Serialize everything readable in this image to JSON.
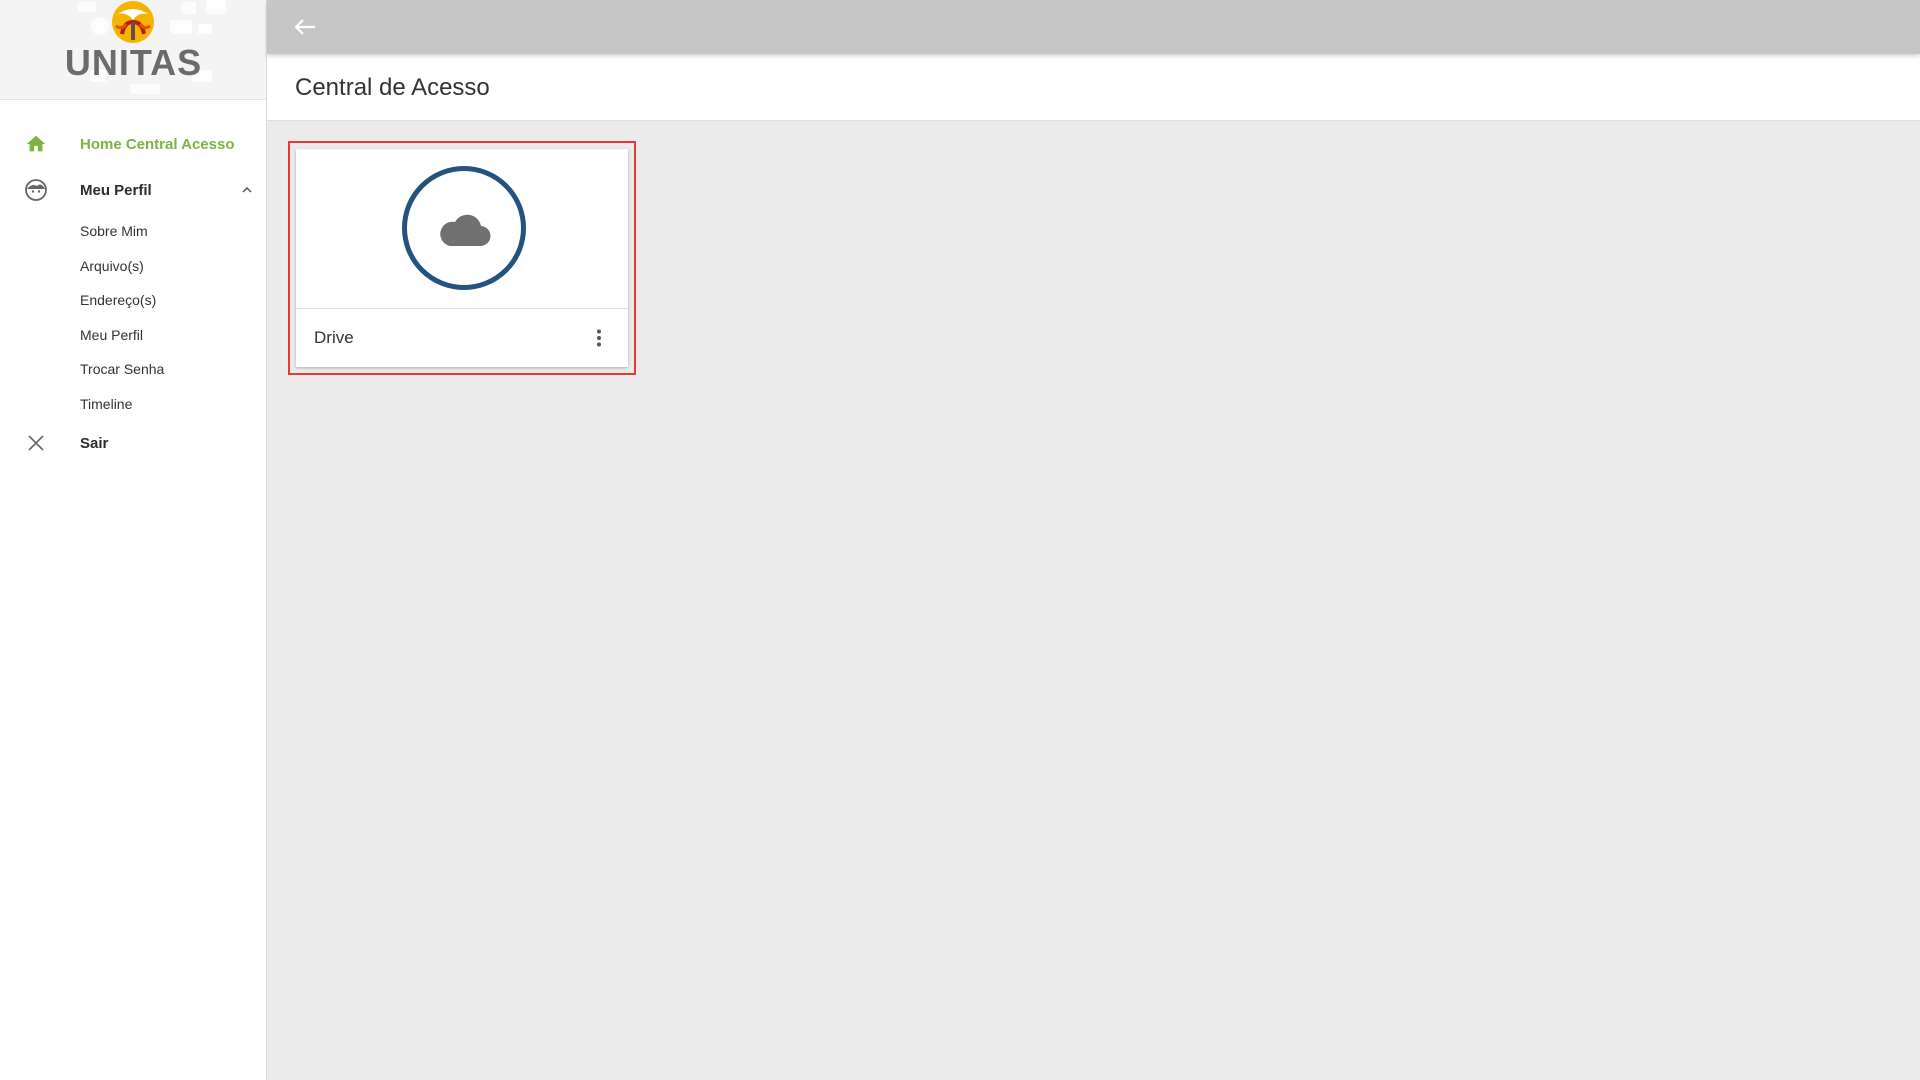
{
  "brand": {
    "name": "UNITAS",
    "logo_icon": "unitas-logo-icon"
  },
  "colors": {
    "accent_green": "#7cb342",
    "topbar": "#c6c6c6",
    "drive_ring": "#24527e",
    "highlight_red": "#e53935"
  },
  "sidebar": {
    "items": [
      {
        "label": "Home Central Acesso",
        "icon": "home-icon",
        "active": true
      },
      {
        "label": "Meu Perfil",
        "icon": "face-icon",
        "expanded": true,
        "children": [
          "Sobre Mim",
          "Arquivo(s)",
          "Endereço(s)",
          "Meu Perfil",
          "Trocar Senha",
          "Timeline"
        ]
      },
      {
        "label": "Sair",
        "icon": "close-icon"
      }
    ]
  },
  "topbar": {
    "back_icon": "arrow-back-icon"
  },
  "page": {
    "title": "Central de Acesso"
  },
  "cards": [
    {
      "label": "Drive",
      "icon": "cloud-icon",
      "menu_icon": "more-vert-icon"
    }
  ]
}
